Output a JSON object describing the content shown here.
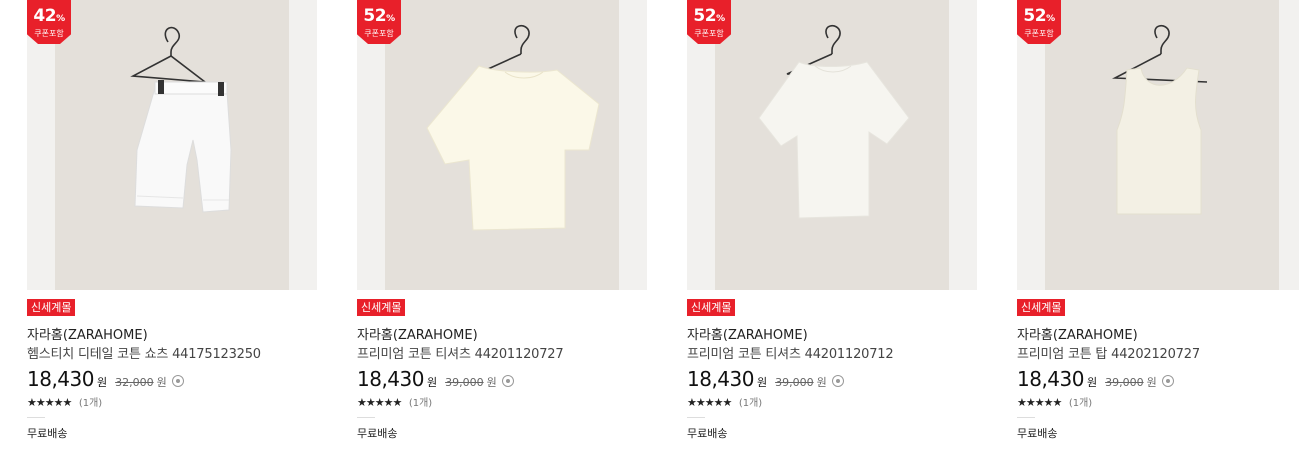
{
  "products": [
    {
      "discount": "42",
      "percent_sign": "%",
      "coupon": "쿠폰포함",
      "tag": "신세계몰",
      "brand": "자라홈(ZARAHOME)",
      "name": "헴스티치 디테일 코튼 쇼츠 44175123250",
      "price": "18,430",
      "price_unit": "원",
      "original_price": "32,000",
      "original_unit": "원",
      "stars": "★★★★★",
      "review_count": "(1개)",
      "shipping": "무료배송",
      "garment": "shorts"
    },
    {
      "discount": "52",
      "percent_sign": "%",
      "coupon": "쿠폰포함",
      "tag": "신세계몰",
      "brand": "자라홈(ZARAHOME)",
      "name": "프리미엄 코튼 티셔츠 44201120727",
      "price": "18,430",
      "price_unit": "원",
      "original_price": "39,000",
      "original_unit": "원",
      "stars": "★★★★★",
      "review_count": "(1개)",
      "shipping": "무료배송",
      "garment": "tshirt-cream"
    },
    {
      "discount": "52",
      "percent_sign": "%",
      "coupon": "쿠폰포함",
      "tag": "신세계몰",
      "brand": "자라홈(ZARAHOME)",
      "name": "프리미엄 코튼 티셔츠 44201120712",
      "price": "18,430",
      "price_unit": "원",
      "original_price": "39,000",
      "original_unit": "원",
      "stars": "★★★★★",
      "review_count": "(1개)",
      "shipping": "무료배송",
      "garment": "tshirt-white"
    },
    {
      "discount": "52",
      "percent_sign": "%",
      "coupon": "쿠폰포함",
      "tag": "신세계몰",
      "brand": "자라홈(ZARAHOME)",
      "name": "프리미엄 코튼 탑 44202120727",
      "price": "18,430",
      "price_unit": "원",
      "original_price": "39,000",
      "original_unit": "원",
      "stars": "★★★★★",
      "review_count": "(1개)",
      "shipping": "무료배송",
      "garment": "tanktop"
    }
  ],
  "colors": {
    "accent": "#e8202a",
    "photo_bg": "#e4e0da",
    "page_bg": "#f2f1ef"
  }
}
